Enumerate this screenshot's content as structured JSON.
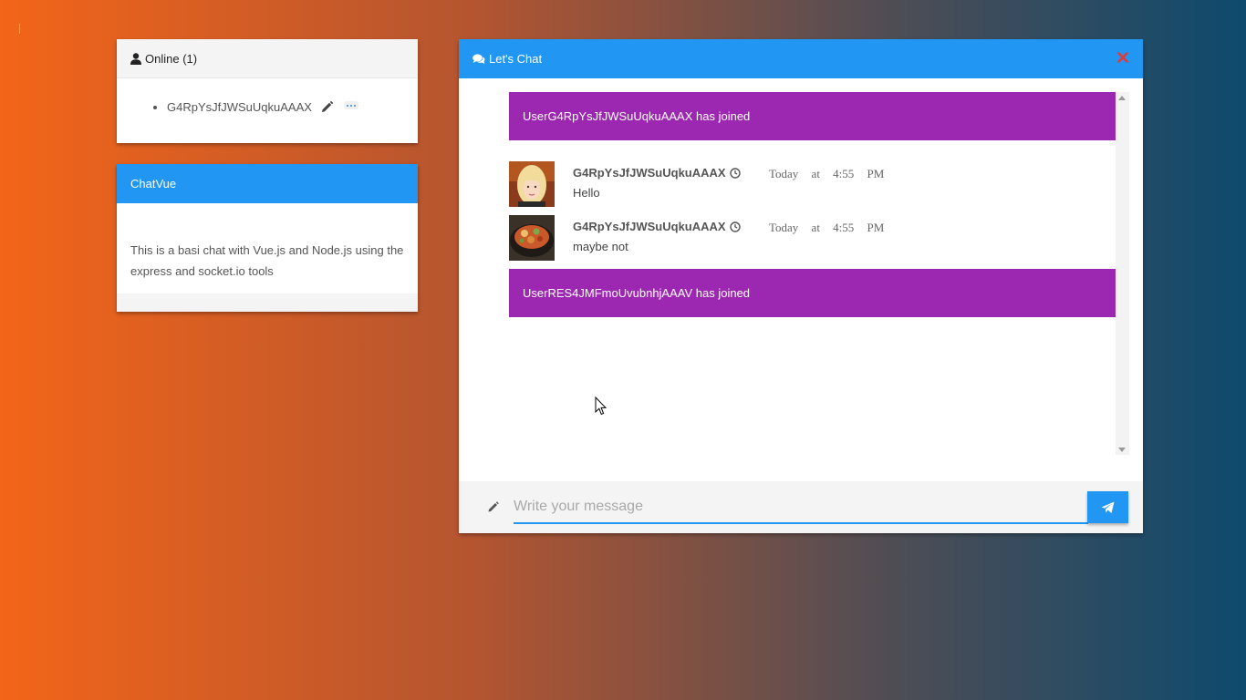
{
  "online": {
    "title": "Online (1)",
    "users": [
      {
        "name": "G4RpYsJfJWSuUqkuAAAX"
      }
    ]
  },
  "info": {
    "title": "ChatVue",
    "description": "This is a basi chat with Vue.js and Node.js using the express and socket.io tools"
  },
  "chat": {
    "title": "Let's Chat",
    "messages": [
      {
        "type": "system",
        "text": "UserG4RpYsJfJWSuUqkuAAAX has joined"
      },
      {
        "type": "user",
        "user": "G4RpYsJfJWSuUqkuAAAX",
        "time": "Today at 4:55 PM",
        "text": "Hello",
        "avatar": "blonde-woman-avatar"
      },
      {
        "type": "user",
        "user": "G4RpYsJfJWSuUqkuAAAX",
        "time": "Today at 4:55 PM",
        "text": "maybe not",
        "avatar": "food-bowl-avatar"
      },
      {
        "type": "system",
        "text": "UserRES4JMFmoUvubnhjAAAV has joined"
      }
    ],
    "input_placeholder": "Write your message"
  },
  "colors": {
    "primary": "#2196f3",
    "system_message": "#9c27b0",
    "close": "#e53935"
  }
}
